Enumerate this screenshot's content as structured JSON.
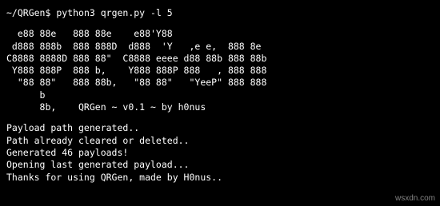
{
  "terminal": {
    "prompt": "~/QRGen$",
    "command": "python3 qrgen.py -l 5",
    "banner": [
      "  e88 88e   888 88e    e88'Y88",
      " d888 888b  888 888D  d888  'Y   ,e e,  888 8e",
      "C8888 8888D 888 88\"  C8888 eeee d88 88b 888 88b",
      " Y888 888P  888 b,    Y888 888P 888   , 888 888",
      "  \"88 88\"   888 88b,   \"88 88\"   \"YeeP\" 888 888",
      "      b",
      "      8b,    QRGen ~ v0.1 ~ by h0nus"
    ],
    "output": [
      "Payload path generated..",
      "Path already cleared or deleted..",
      "Generated 46 payloads!",
      "Opening last generated payload...",
      "Thanks for using QRGen, made by H0nus.."
    ]
  },
  "watermark": "wsxdn.com",
  "colors": {
    "background": "#000000",
    "text": "#ffffff"
  }
}
